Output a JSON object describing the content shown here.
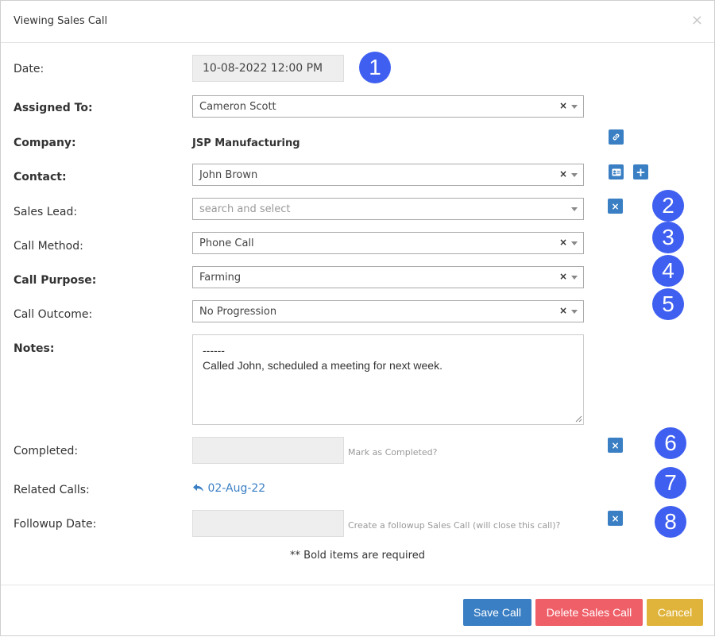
{
  "modal": {
    "title": "Viewing Sales Call",
    "close_glyph": "×"
  },
  "fields": {
    "date": {
      "label": "Date:",
      "value": "10-08-2022 12:00 PM"
    },
    "assigned_to": {
      "label": "Assigned To:",
      "value": "Cameron Scott"
    },
    "company": {
      "label": "Company:",
      "value": "JSP Manufacturing"
    },
    "contact": {
      "label": "Contact:",
      "value": "John Brown"
    },
    "sales_lead": {
      "label": "Sales Lead:",
      "placeholder": "search and select"
    },
    "call_method": {
      "label": "Call Method:",
      "value": "Phone Call"
    },
    "call_purpose": {
      "label": "Call Purpose:",
      "value": "Farming"
    },
    "call_outcome": {
      "label": "Call Outcome:",
      "value": "No Progression"
    },
    "notes": {
      "label": "Notes:",
      "value": "------\nCalled John, scheduled a meeting for next week."
    },
    "completed": {
      "label": "Completed:",
      "hint": "Mark as Completed?"
    },
    "related_calls": {
      "label": "Related Calls:",
      "link_text": "02-Aug-22"
    },
    "followup_date": {
      "label": "Followup Date:",
      "hint": "Create a followup Sales Call (will close this call)?"
    }
  },
  "clear_glyph": "×",
  "required_note": "** Bold items are required",
  "badges": [
    "1",
    "2",
    "3",
    "4",
    "5",
    "6",
    "7",
    "8"
  ],
  "footer": {
    "save_label": "Save Call",
    "delete_label": "Delete Sales Call",
    "cancel_label": "Cancel"
  },
  "icons": [
    "link-icon",
    "contact-card-icon",
    "plus-icon",
    "clear-icon",
    "reply-arrow-icon",
    "chevron-down-icon"
  ],
  "colors": {
    "primary": "#3a7fc4",
    "danger": "#ef5f68",
    "warning": "#e0b43b",
    "badge": "#3f5ff0"
  }
}
